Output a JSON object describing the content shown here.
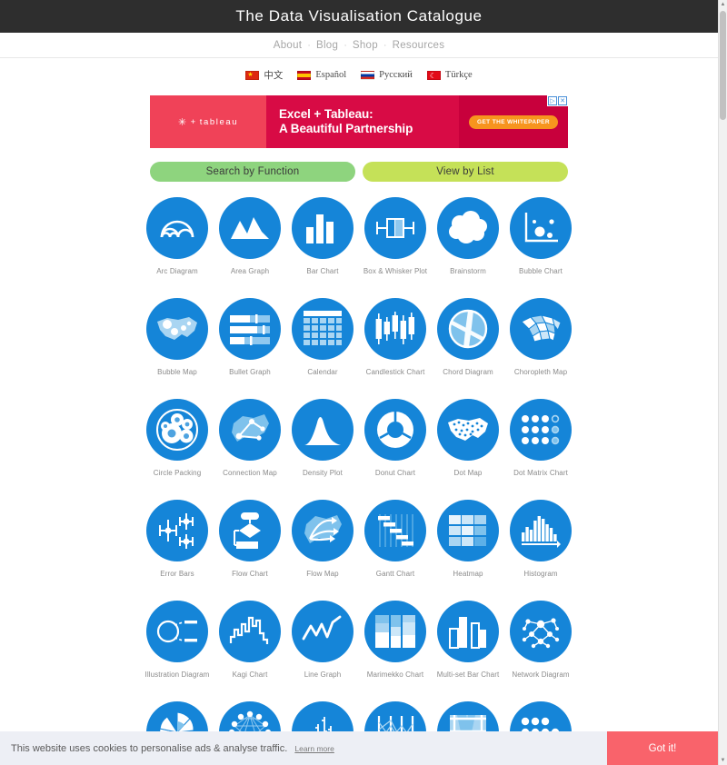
{
  "site": {
    "title": "The Data Visualisation Catalogue"
  },
  "nav": {
    "separator": "·",
    "items": [
      {
        "label": "About"
      },
      {
        "label": "Blog"
      },
      {
        "label": "Shop"
      },
      {
        "label": "Resources"
      }
    ]
  },
  "languages": [
    {
      "label": "中文",
      "flag": "flag-cn-icon"
    },
    {
      "label": "Español",
      "flag": "flag-es-icon"
    },
    {
      "label": "Русский",
      "flag": "flag-ru-icon"
    },
    {
      "label": "Türkçe",
      "flag": "flag-tr-icon"
    }
  ],
  "ad": {
    "brand": "tableau",
    "brand_mark": "✳",
    "brand_plus": "+",
    "headline_line1": "Excel + Tableau:",
    "headline_line2": "A Beautiful Partnership",
    "cta_label": "GET THE WHITEPAPER",
    "adchoices_glyph": "▷",
    "close_glyph": "✕"
  },
  "modes": {
    "search_by_function": {
      "label": "Search by Function",
      "color": "#8ed47e"
    },
    "view_by_list": {
      "label": "View by List",
      "color": "#c5e158"
    }
  },
  "grid": {
    "circle_color": "#1585d8",
    "items": [
      {
        "label": "Arc Diagram",
        "icon": "arc-diagram-icon"
      },
      {
        "label": "Area Graph",
        "icon": "area-graph-icon"
      },
      {
        "label": "Bar Chart",
        "icon": "bar-chart-icon"
      },
      {
        "label": "Box & Whisker Plot",
        "icon": "box-whisker-plot-icon"
      },
      {
        "label": "Brainstorm",
        "icon": "brainstorm-icon"
      },
      {
        "label": "Bubble Chart",
        "icon": "bubble-chart-icon"
      },
      {
        "label": "Bubble Map",
        "icon": "bubble-map-icon"
      },
      {
        "label": "Bullet Graph",
        "icon": "bullet-graph-icon"
      },
      {
        "label": "Calendar",
        "icon": "calendar-icon"
      },
      {
        "label": "Candlestick Chart",
        "icon": "candlestick-chart-icon"
      },
      {
        "label": "Chord Diagram",
        "icon": "chord-diagram-icon"
      },
      {
        "label": "Choropleth Map",
        "icon": "choropleth-map-icon"
      },
      {
        "label": "Circle Packing",
        "icon": "circle-packing-icon"
      },
      {
        "label": "Connection Map",
        "icon": "connection-map-icon"
      },
      {
        "label": "Density Plot",
        "icon": "density-plot-icon"
      },
      {
        "label": "Donut Chart",
        "icon": "donut-chart-icon"
      },
      {
        "label": "Dot Map",
        "icon": "dot-map-icon"
      },
      {
        "label": "Dot Matrix Chart",
        "icon": "dot-matrix-chart-icon"
      },
      {
        "label": "Error Bars",
        "icon": "error-bars-icon"
      },
      {
        "label": "Flow Chart",
        "icon": "flow-chart-icon"
      },
      {
        "label": "Flow Map",
        "icon": "flow-map-icon"
      },
      {
        "label": "Gantt Chart",
        "icon": "gantt-chart-icon"
      },
      {
        "label": "Heatmap",
        "icon": "heatmap-icon"
      },
      {
        "label": "Histogram",
        "icon": "histogram-icon"
      },
      {
        "label": "Illustration Diagram",
        "icon": "illustration-diagram-icon"
      },
      {
        "label": "Kagi Chart",
        "icon": "kagi-chart-icon"
      },
      {
        "label": "Line Graph",
        "icon": "line-graph-icon"
      },
      {
        "label": "Marimekko Chart",
        "icon": "marimekko-chart-icon"
      },
      {
        "label": "Multi-set Bar Chart",
        "icon": "multi-set-bar-chart-icon"
      },
      {
        "label": "Network Diagram",
        "icon": "network-diagram-icon"
      },
      {
        "label": "",
        "icon": "nightingale-rose-chart-icon"
      },
      {
        "label": "",
        "icon": "non-ribbon-chord-diagram-icon"
      },
      {
        "label": "",
        "icon": "ohlc-chart-icon"
      },
      {
        "label": "",
        "icon": "parallel-coordinates-plot-icon"
      },
      {
        "label": "",
        "icon": "parallel-sets-icon"
      },
      {
        "label": "",
        "icon": "pictogram-chart-icon"
      }
    ]
  },
  "cookie": {
    "message": "This website uses cookies to personalise ads & analyse traffic.",
    "learn_more": "Learn more",
    "accept_label": "Got it!",
    "accept_color": "#f9636b"
  },
  "scrollbar": {
    "up_glyph": "▲",
    "down_glyph": "▼"
  }
}
